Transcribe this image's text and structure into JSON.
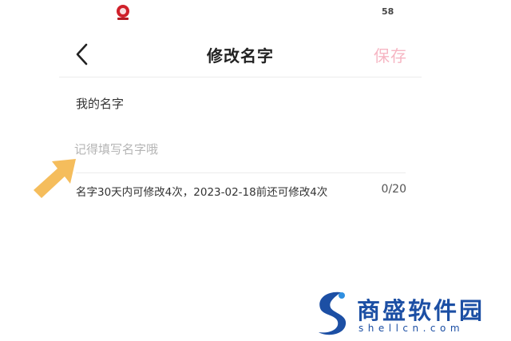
{
  "status_bar": {
    "right_text": "58"
  },
  "header": {
    "title": "修改名字",
    "save_label": "保存"
  },
  "form": {
    "label": "我的名字",
    "input_value": "",
    "input_placeholder": "记得填写名字哦",
    "hint": "名字30天内可修改4次，2023-02-18前还可修改4次",
    "counter": "0/20"
  },
  "watermark": {
    "name": "商盛软件园",
    "url": "shellcn.com"
  },
  "colors": {
    "save_button": "#f6b6c3",
    "arrow": "#f5bd5c",
    "watermark": "#1c4fa4",
    "app_icon": "#d0202a"
  },
  "icons": [
    "app-icon",
    "back-arrow-icon",
    "pointer-arrow-icon",
    "watermark-logo-icon"
  ]
}
